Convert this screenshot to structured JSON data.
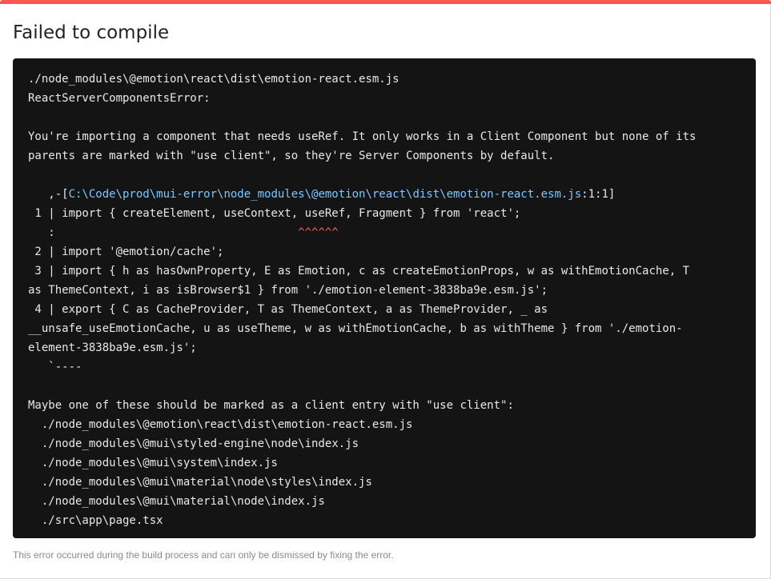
{
  "colors": {
    "accent_bar": "#ff5555",
    "terminal_bg": "#141414",
    "terminal_text": "#e8e8e8",
    "path_link": "#7cc7ff",
    "error_carets": "#ff5a5a"
  },
  "header": {
    "title": "Failed to compile"
  },
  "terminal": {
    "lines": [
      "./node_modules\\@emotion\\react\\dist\\emotion-react.esm.js",
      "ReactServerComponentsError:",
      "",
      "You're importing a component that needs useRef. It only works in a Client Component but none of its",
      "parents are marked with \"use client\", so they're Server Components by default.",
      "",
      "   ,-[",
      " 1 | import { createElement, useContext, useRef, Fragment } from 'react';",
      "   :                                    ",
      " 2 | import '@emotion/cache';",
      " 3 | import { h as hasOwnProperty, E as Emotion, c as createEmotionProps, w as withEmotionCache, T",
      "as ThemeContext, i as isBrowser$1 } from './emotion-element-3838ba9e.esm.js';",
      " 4 | export { C as CacheProvider, T as ThemeContext, a as ThemeProvider, _ as",
      "__unsafe_useEmotionCache, u as useTheme, w as withEmotionCache, b as withTheme } from './emotion-",
      "element-3838ba9e.esm.js';",
      "   `----",
      "",
      "Maybe one of these should be marked as a client entry with \"use client\":",
      "  ./node_modules\\@emotion\\react\\dist\\emotion-react.esm.js",
      "  ./node_modules\\@mui\\styled-engine\\node\\index.js",
      "  ./node_modules\\@mui\\system\\index.js",
      "  ./node_modules\\@mui\\material\\node\\styles\\index.js",
      "  ./node_modules\\@mui\\material\\node\\index.js",
      "  ./src\\app\\page.tsx"
    ],
    "source_link": "C:\\Code\\prod\\mui-error\\node_modules\\@emotion\\react\\dist\\emotion-react.esm.js",
    "source_location": ":1:1]",
    "carets": "^^^^^^"
  },
  "footer": {
    "message": "This error occurred during the build process and can only be dismissed by fixing the error."
  }
}
